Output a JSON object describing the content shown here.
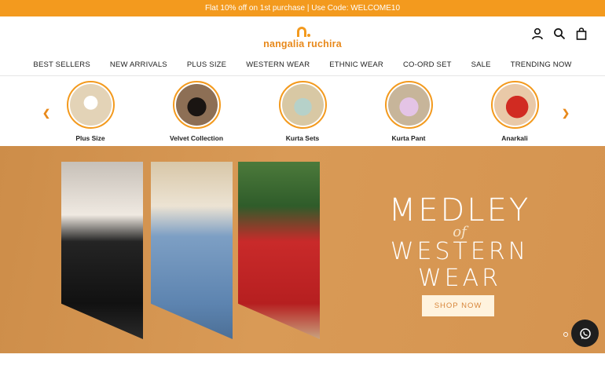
{
  "announcement": "Flat 10% off on 1st purchase | Use Code: WELCOME10",
  "logo": {
    "text": "nangalia ruchira"
  },
  "header_icons": [
    "account-icon",
    "search-icon",
    "cart-icon"
  ],
  "nav": [
    "BEST SELLERS",
    "NEW ARRIVALS",
    "PLUS SIZE",
    "WESTERN WEAR",
    "ETHNIC WEAR",
    "CO-ORD SET",
    "SALE",
    "TRENDING NOW"
  ],
  "categories": [
    {
      "label": "Plus Size",
      "color": "#e9dcc6"
    },
    {
      "label": "Velvet Collection",
      "color": "#5a4635"
    },
    {
      "label": "Kurta Sets",
      "color": "#a9c3a2"
    },
    {
      "label": "Kurta Pant",
      "color": "#d7b7d3"
    },
    {
      "label": "Anarkali",
      "color": "#c43a2a"
    }
  ],
  "hero": {
    "line1": "MEDLEY",
    "line2": "of",
    "line3": "WESTERN WEAR",
    "cta": "SHOP NOW"
  },
  "colors": {
    "accent": "#f39a1e",
    "hero_bg": "#d4944f"
  }
}
